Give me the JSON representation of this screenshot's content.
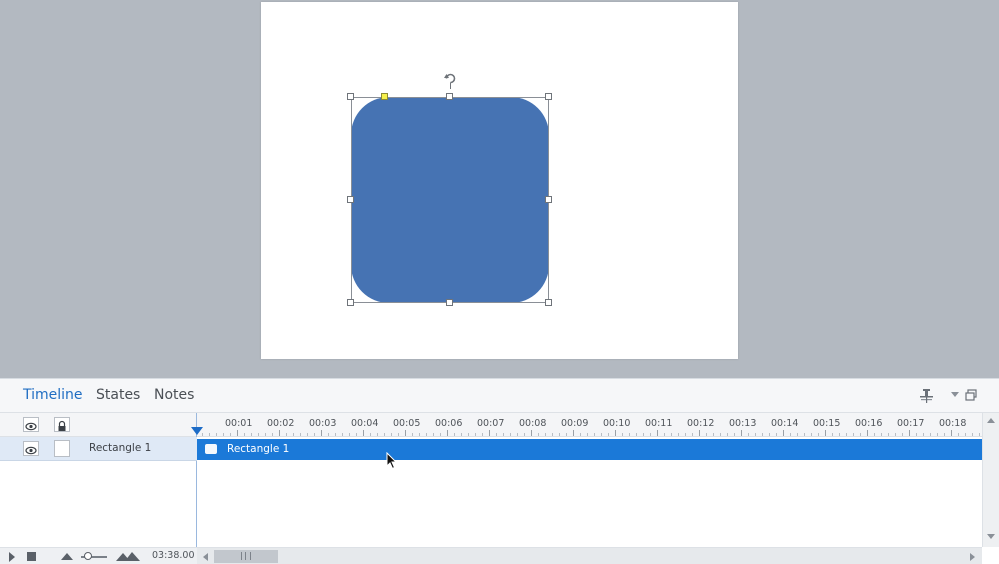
{
  "panel": {
    "tabs": [
      {
        "label": "Timeline",
        "active": true
      },
      {
        "label": "States",
        "active": false
      },
      {
        "label": "Notes",
        "active": false
      }
    ],
    "icons": [
      "pin-icon",
      "dropdown-icon",
      "restore-icon"
    ]
  },
  "timeline": {
    "ruler_ticks": [
      "00:01",
      "00:02",
      "00:03",
      "00:04",
      "00:05",
      "00:06",
      "00:07",
      "00:08",
      "00:09",
      "00:10",
      "00:11",
      "00:12",
      "00:13",
      "00:14",
      "00:15",
      "00:16",
      "00:17",
      "00:18"
    ],
    "layer": {
      "name": "Rectangle 1",
      "clip_label": "Rectangle 1"
    },
    "duration": "03:38.00"
  },
  "colors": {
    "shape_fill": "#4673b3",
    "clip_fill": "#1b79d8",
    "active_tab": "#1f6dc2",
    "stage_background": "#b3b9c1"
  }
}
